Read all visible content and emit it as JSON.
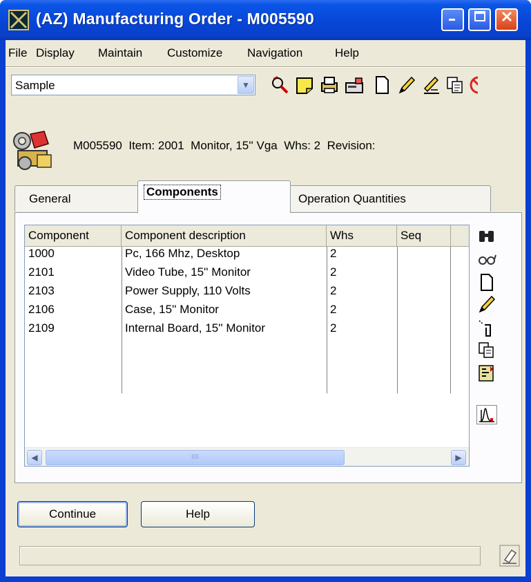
{
  "window": {
    "title": "(AZ) Manufacturing Order - M005590",
    "colors": {
      "titlebar": "#0746d8",
      "client": "#ece9d8",
      "close_button": "#d8401b"
    }
  },
  "menu": [
    {
      "label": "File"
    },
    {
      "label": "Display"
    },
    {
      "label": "Maintain"
    },
    {
      "label": "Customize"
    },
    {
      "label": "Navigation"
    },
    {
      "label": "Help"
    }
  ],
  "toolbar": {
    "view_select": {
      "value": "Sample"
    },
    "icons": [
      "find-icon",
      "note-icon",
      "print-icon",
      "fax-icon",
      "new-document-icon",
      "edit-pencil-icon",
      "edit-note-icon",
      "copy-icon",
      "delete-icon"
    ]
  },
  "header": {
    "order": "M005590",
    "item_label": "Item:",
    "item": "2001",
    "description": "Monitor, 15'' Vga",
    "whs_label": "Whs:",
    "whs": "2",
    "revision_label": "Revision:"
  },
  "tabs": [
    {
      "label": "General",
      "active": false
    },
    {
      "label": "Components",
      "active": true
    },
    {
      "label": "Operation Quantities",
      "active": false
    }
  ],
  "grid": {
    "columns": [
      "Component",
      "Component description",
      "Whs",
      "Seq"
    ],
    "rows": [
      {
        "component": "1000",
        "description": "Pc, 166 Mhz, Desktop",
        "whs": "2",
        "seq": ""
      },
      {
        "component": "2101",
        "description": "Video Tube, 15'' Monitor",
        "whs": "2",
        "seq": ""
      },
      {
        "component": "2103",
        "description": "Power Supply, 110 Volts",
        "whs": "2",
        "seq": ""
      },
      {
        "component": "2106",
        "description": "Case, 15'' Monitor",
        "whs": "2",
        "seq": ""
      },
      {
        "component": "2109",
        "description": "Internal Board, 15'' Monitor",
        "whs": "2",
        "seq": ""
      }
    ],
    "scrollbar_thumb_grip": "IIII"
  },
  "side_tools": [
    "binoculars-icon",
    "glasses-icon",
    "new-page-icon",
    "pencil-icon",
    "flashlight-icon",
    "copy-pages-icon",
    "structure-icon",
    "chart-icon"
  ],
  "buttons": {
    "continue": "Continue",
    "help": "Help"
  },
  "statusbar": {
    "text": ""
  }
}
